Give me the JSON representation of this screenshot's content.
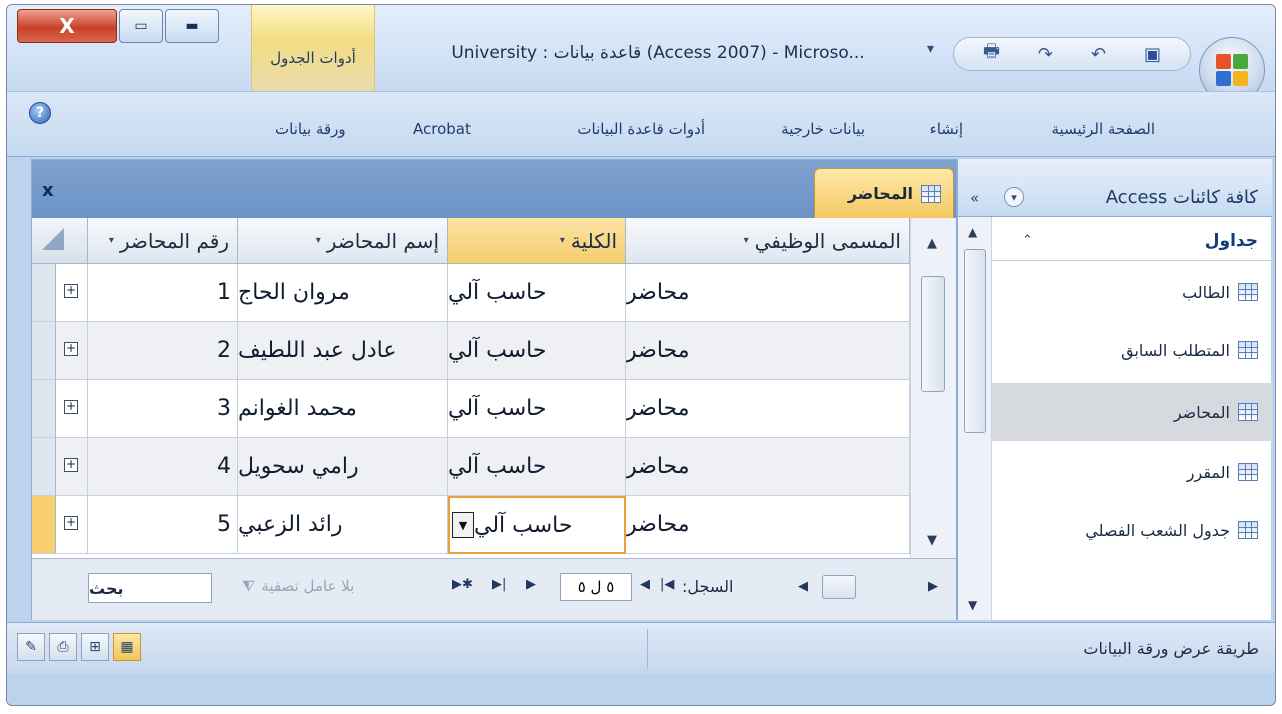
{
  "window": {
    "title": "University : قاعدة بيانات (Access 2007) - Microso...",
    "context_tab": "أدوات الجدول",
    "controls": {
      "close": "X",
      "restore": "▭",
      "minimize": "▬"
    }
  },
  "qat": {
    "icons": [
      "save-icon",
      "undo-icon",
      "redo-icon",
      "print-icon"
    ],
    "dropdown": "▾"
  },
  "ribbon": {
    "help": "?",
    "tabs": [
      "الصفحة الرئيسية",
      "إنشاء",
      "بيانات خارجية",
      "أدوات قاعدة البيانات",
      "Acrobat",
      "ورقة بيانات"
    ]
  },
  "navpane": {
    "title": "كافة كائنات Access",
    "collapse": "«",
    "dropdown": "▾",
    "group": "جداول",
    "group_chevron": "⌃",
    "items": [
      {
        "label": "الطالب",
        "selected": false
      },
      {
        "label": "المتطلب السابق",
        "selected": false
      },
      {
        "label": "المحاضر",
        "selected": true
      },
      {
        "label": "المقرر",
        "selected": false
      },
      {
        "label": "جدول الشعب الفصلي",
        "selected": false
      }
    ]
  },
  "document": {
    "tab_label": "المحاضر",
    "close": "x",
    "columns": [
      "المسمى الوظيفي",
      "الكلية",
      "إسم المحاضر",
      "رقم المحاضر"
    ],
    "column_arrow": "▾",
    "rows": [
      {
        "title": "محاضر",
        "college": "حاسب آلي",
        "name": "مروان الحاج",
        "id": "1"
      },
      {
        "title": "محاضر",
        "college": "حاسب آلي",
        "name": "عادل عبد اللطيف",
        "id": "2"
      },
      {
        "title": "محاضر",
        "college": "حاسب آلي",
        "name": "محمد الغوانم",
        "id": "3"
      },
      {
        "title": "محاضر",
        "college": "حاسب آلي",
        "name": "رامي سحويل",
        "id": "4"
      },
      {
        "title": "محاضر",
        "college": "حاسب آلي",
        "name": "رائد الزعبي",
        "id": "5"
      }
    ],
    "expand_glyph": "+"
  },
  "recordbar": {
    "label": "السجل:",
    "current": "٥ ل ٥",
    "filter": "بلا عامل تصفية",
    "search": "بحث"
  },
  "status": {
    "text": "طريقة عرض ورقة البيانات"
  }
}
